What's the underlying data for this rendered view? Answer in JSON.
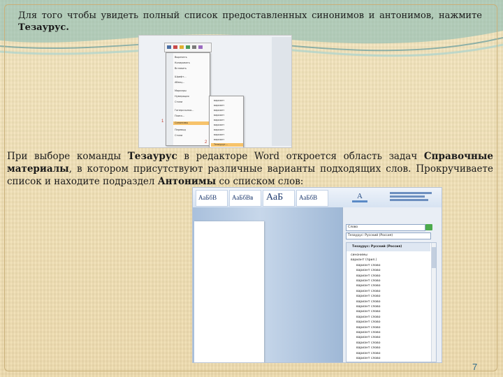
{
  "slide": {
    "paragraph1": {
      "text": "Для того чтобы увидеть полный список предоставленных синонимов и антонимов, нажмите ",
      "bold": "Тезаурус."
    },
    "paragraph2": {
      "t1": "При выборе команды ",
      "b1": "Тезаурус",
      "t2": " в редакторе Word откроется область задач ",
      "b2": "Справочные материалы",
      "t3": ", в котором присутствуют различные варианты подходящих слов. Прокручиваете список и находите подраздел ",
      "b3": "Антонимы",
      "t4": " со списком слов:"
    },
    "page_number": "7"
  },
  "screenshot1": {
    "marker1": "1",
    "marker2": "2",
    "context_menu": [
      "Вырезать",
      "Копировать",
      "Вставить",
      "Шрифт...",
      "Абзац...",
      "Маркеры",
      "Нумерация",
      "Стили",
      "Гиперссылка...",
      "Поиск...",
      "Синонимы",
      "Перевод",
      "Стили"
    ],
    "submenu": [
      "вариант",
      "вариант",
      "вариант",
      "вариант",
      "вариант",
      "вариант",
      "вариант",
      "вариант",
      "вариант",
      "Тезаурус..."
    ]
  },
  "screenshot2": {
    "styles": [
      "АаБбВ",
      "АаБбВв",
      "АаБ",
      "АаБбВ"
    ],
    "search_value": "Слово",
    "source_value": "Тезаурус: Русский (Россия)",
    "panel_header": "Тезаурус: Русский (Россия)",
    "thesaurus_entries": [
      "синонимы",
      "вариант (прил.)",
      "вариант слово",
      "вариант слово",
      "вариант слово",
      "вариант слово",
      "вариант слово",
      "вариант слово",
      "вариант слово",
      "вариант слово",
      "вариант слово",
      "вариант слово",
      "вариант слово",
      "вариант слово",
      "вариант слово",
      "вариант слово",
      "вариант слово",
      "вариант слово",
      "вариант слово",
      "вариант слово",
      "вариант слово"
    ]
  },
  "colors": {
    "accent": "#2e6b8a",
    "highlight": "#f7c36a",
    "wave": "#7fb8b4"
  }
}
